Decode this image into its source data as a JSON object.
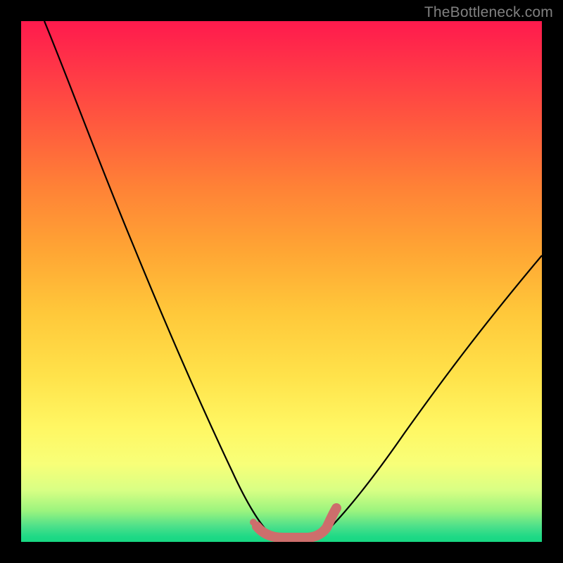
{
  "watermark": "TheBottleneck.com",
  "chart_data": {
    "type": "line",
    "title": "",
    "xlabel": "",
    "ylabel": "",
    "xlim": [
      0,
      100
    ],
    "ylim": [
      0,
      100
    ],
    "grid": false,
    "legend": false,
    "series": [
      {
        "name": "left-curve",
        "color": "#000000",
        "x": [
          5,
          10,
          15,
          20,
          25,
          30,
          35,
          40,
          45,
          48
        ],
        "values": [
          100,
          90,
          78,
          66,
          55,
          44,
          33,
          22,
          10,
          2
        ]
      },
      {
        "name": "right-curve",
        "color": "#000000",
        "x": [
          58,
          62,
          68,
          74,
          80,
          86,
          92,
          100
        ],
        "values": [
          2,
          8,
          16,
          24,
          32,
          39,
          46,
          55
        ]
      },
      {
        "name": "valley-marker",
        "color": "#d17070",
        "x": [
          45,
          48,
          51,
          54,
          57,
          59,
          60
        ],
        "values": [
          3,
          1,
          1,
          1,
          1,
          3,
          5
        ]
      }
    ],
    "background_gradient": {
      "top": "#ff1a4d",
      "mid": "#ffe24a",
      "bottom": "#18d882"
    }
  }
}
